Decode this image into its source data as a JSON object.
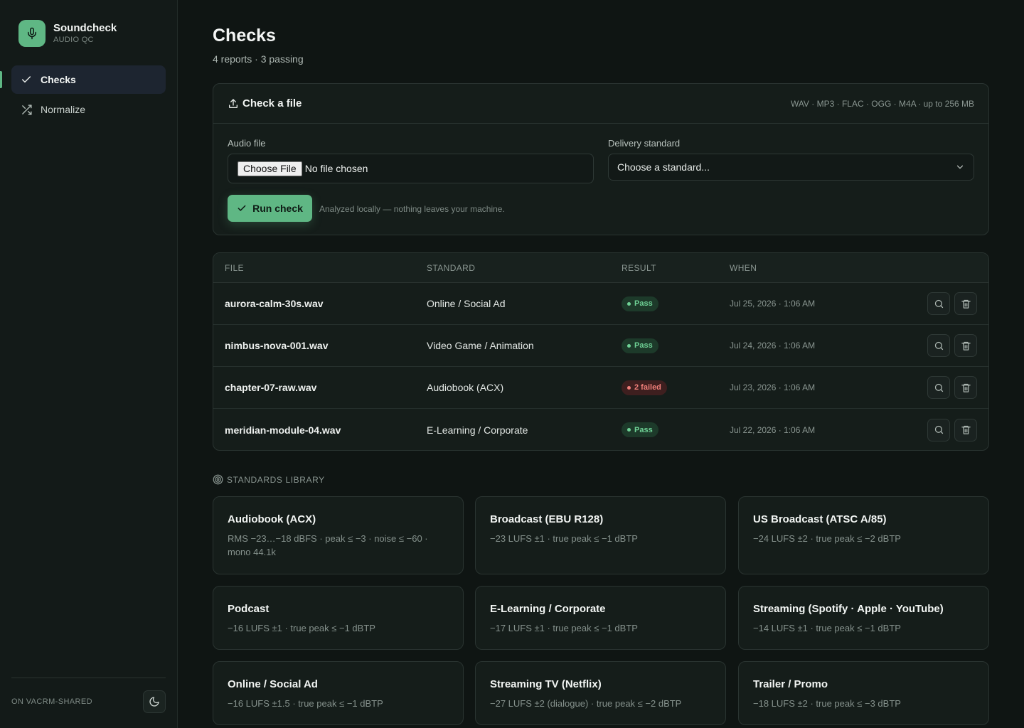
{
  "app": {
    "name": "Soundcheck",
    "subtitle": "AUDIO QC"
  },
  "nav": [
    {
      "label": "Checks",
      "icon": "check-icon",
      "active": true
    },
    {
      "label": "Normalize",
      "icon": "shuffle-icon",
      "active": false
    }
  ],
  "footer": {
    "workspace": "ON VACRM-SHARED",
    "theme_icon": "moon-icon"
  },
  "page": {
    "title": "Checks",
    "subtitle": "4 reports · 3 passing"
  },
  "upload": {
    "title": "Check a file",
    "formats": "WAV · MP3 · FLAC · OGG · M4A · up to 256 MB",
    "file_label": "Audio file",
    "choose_button": "Choose File",
    "file_status": "No file chosen",
    "standard_label": "Delivery standard",
    "standard_placeholder": "Choose a standard...",
    "run_button": "Run check",
    "note": "Analyzed locally — nothing leaves your machine."
  },
  "table": {
    "headers": {
      "file": "FILE",
      "standard": "STANDARD",
      "result": "RESULT",
      "when": "WHEN"
    },
    "rows": [
      {
        "file": "aurora-calm-30s.wav",
        "standard": "Online / Social Ad",
        "result": "Pass",
        "status": "pass",
        "when": "Jul 25, 2026 · 1:06 AM"
      },
      {
        "file": "nimbus-nova-001.wav",
        "standard": "Video Game / Animation",
        "result": "Pass",
        "status": "pass",
        "when": "Jul 24, 2026 · 1:06 AM"
      },
      {
        "file": "chapter-07-raw.wav",
        "standard": "Audiobook (ACX)",
        "result": "2 failed",
        "status": "fail",
        "when": "Jul 23, 2026 · 1:06 AM"
      },
      {
        "file": "meridian-module-04.wav",
        "standard": "E-Learning / Corporate",
        "result": "Pass",
        "status": "pass",
        "when": "Jul 22, 2026 · 1:06 AM"
      }
    ]
  },
  "library": {
    "title": "STANDARDS LIBRARY",
    "standards": [
      {
        "name": "Audiobook (ACX)",
        "spec": "RMS −23…−18 dBFS · peak ≤ −3 · noise ≤ −60 · mono 44.1k"
      },
      {
        "name": "Broadcast (EBU R128)",
        "spec": "−23 LUFS ±1 · true peak ≤ −1 dBTP"
      },
      {
        "name": "US Broadcast (ATSC A/85)",
        "spec": "−24 LUFS ±2 · true peak ≤ −2 dBTP"
      },
      {
        "name": "Podcast",
        "spec": "−16 LUFS ±1 · true peak ≤ −1 dBTP"
      },
      {
        "name": "E-Learning / Corporate",
        "spec": "−17 LUFS ±1 · true peak ≤ −1 dBTP"
      },
      {
        "name": "Streaming (Spotify · Apple · YouTube)",
        "spec": "−14 LUFS ±1 · true peak ≤ −1 dBTP"
      },
      {
        "name": "Online / Social Ad",
        "spec": "−16 LUFS ±1.5 · true peak ≤ −1 dBTP"
      },
      {
        "name": "Streaming TV (Netflix)",
        "spec": "−27 LUFS ±2 (dialogue) · true peak ≤ −2 dBTP"
      },
      {
        "name": "Trailer / Promo",
        "spec": "−18 LUFS ±2 · true peak ≤ −3 dBTP"
      }
    ]
  },
  "colors": {
    "accent": "#5fb784",
    "background": "#0f1513",
    "pass": "#6fd296",
    "fail": "#f07f7a"
  }
}
